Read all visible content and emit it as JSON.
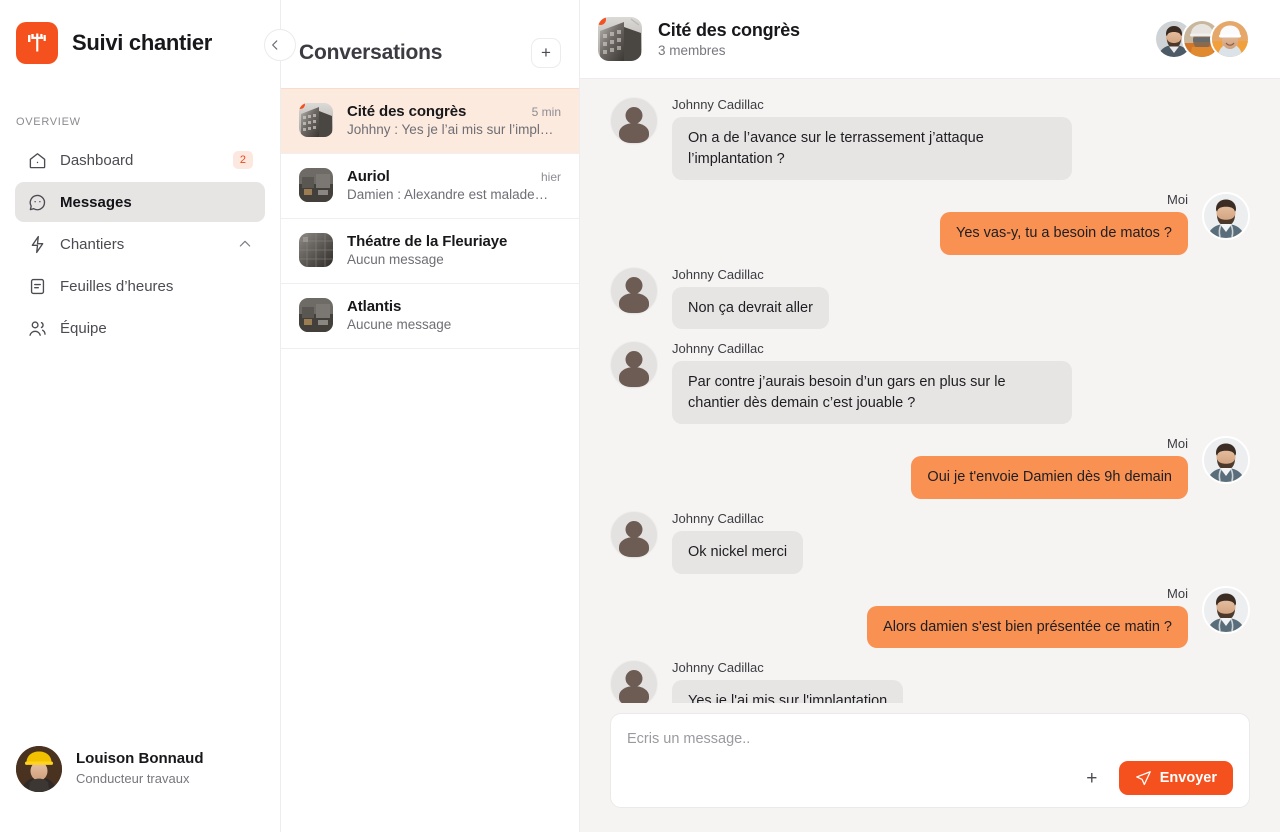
{
  "app": {
    "brand_title": "Suivi chantier",
    "logo_icon": "construction-crane-icon"
  },
  "sidebar": {
    "section_label": "OVERVIEW",
    "items": [
      {
        "label": "Dashboard",
        "icon": "home-icon",
        "badge": "2",
        "active": false
      },
      {
        "label": "Messages",
        "icon": "chat-bubble-icon",
        "badge": "",
        "active": true
      },
      {
        "label": "Chantiers",
        "icon": "zap-icon",
        "badge": "",
        "active": false,
        "chevron": "chevron-up-icon"
      },
      {
        "label": "Feuilles d’heures",
        "icon": "document-icon",
        "badge": "",
        "active": false
      },
      {
        "label": "Équipe",
        "icon": "users-icon",
        "badge": "",
        "active": false
      }
    ],
    "user": {
      "name": "Louison Bonnaud",
      "role": "Conducteur travaux",
      "avatar": "worker-yellow-helmet-avatar"
    },
    "collapse_icon": "chevron-left-icon"
  },
  "conversations": {
    "title": "Conversations",
    "add_label": "+",
    "items": [
      {
        "name": "Cité des congrès",
        "preview": "Johhny : Yes je l’ai mis sur l’impl…",
        "time": "5 min",
        "unread": true,
        "selected": true
      },
      {
        "name": "Auriol",
        "preview": "Damien : Alexandre est malade…",
        "time": "hier",
        "unread": false,
        "selected": false
      },
      {
        "name": "Théatre de la Fleuriaye",
        "preview": "Aucun message",
        "time": "",
        "unread": false,
        "selected": false
      },
      {
        "name": "Atlantis",
        "preview": "Aucune message",
        "time": "",
        "unread": false,
        "selected": false
      }
    ]
  },
  "chat": {
    "title": "Cité des congrès",
    "subtitle": "3 membres",
    "unread": true,
    "members": [
      {
        "name": "member-1",
        "avatar": "bearded-worker-avatar"
      },
      {
        "name": "member-2",
        "avatar": "helmet-goggles-worker-avatar"
      },
      {
        "name": "member-3",
        "avatar": "white-helmet-worker-avatar"
      }
    ],
    "messages": [
      {
        "side": "them",
        "author": "Johnny Cadillac",
        "text": "On a de l’avance sur le terrassement j’attaque l’implantation ?",
        "wide": true
      },
      {
        "side": "me",
        "author": "Moi",
        "text": "Yes vas-y, tu a besoin de matos ?",
        "wide": false
      },
      {
        "side": "them",
        "author": "Johnny Cadillac",
        "text": "Non ça devrait aller",
        "wide": false
      },
      {
        "side": "them",
        "author": "Johnny Cadillac",
        "text": "Par contre j’aurais besoin d’un gars en plus sur le chantier dès demain c’est jouable ?",
        "wide": true
      },
      {
        "side": "me",
        "author": "Moi",
        "text": "Oui je t'envoie Damien dès 9h demain",
        "wide": false
      },
      {
        "side": "them",
        "author": "Johnny Cadillac",
        "text": "Ok nickel merci",
        "wide": false
      },
      {
        "side": "me",
        "author": "Moi",
        "text": "Alors damien s'est bien présentée ce matin ?",
        "wide": false
      },
      {
        "side": "them",
        "author": "Johnny Cadillac",
        "text": "Yes je l'ai mis sur l'implantation",
        "wide": false
      }
    ],
    "composer": {
      "placeholder": "Ecris un message..",
      "value": "",
      "attach_label": "+",
      "send_label": "Envoyer",
      "send_icon": "paper-plane-icon"
    }
  },
  "colors": {
    "brand_orange": "#f4511e",
    "bubble_me": "#f99153",
    "bubble_them": "#e7e5e4",
    "selected_conv": "#fdeade",
    "chat_bg": "#f5f4f3",
    "badge_bg": "#fde8df",
    "badge_text": "#e8491f"
  }
}
